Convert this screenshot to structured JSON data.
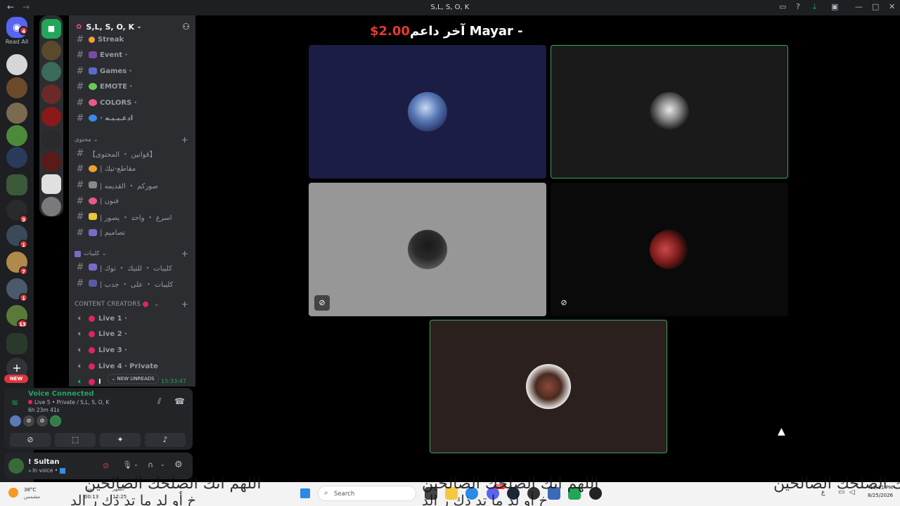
{
  "titlebar": {
    "title": "S,L, S, O, K"
  },
  "rail": {
    "read_all": "Read All",
    "new_badge": "NEW",
    "dm_badge": "4",
    "badges": [
      "3",
      "1",
      "7",
      "1",
      "13"
    ]
  },
  "server": {
    "name": "S,L, S, O, K"
  },
  "channels": [
    {
      "name": "Streak"
    },
    {
      "name": "Event ·"
    },
    {
      "name": "Games ·"
    },
    {
      "name": "EMOTE ·"
    },
    {
      "name": "COLORS ·"
    },
    {
      "name": "· ادعـيـيـه"
    }
  ],
  "categories": {
    "content": "محتوى",
    "clips": "كليبات",
    "creators": "CONTENT CREATORS"
  },
  "content_channels": [
    {
      "name": "【قوانين ・ المحتوى】"
    },
    {
      "name": "| مقاطع-تيك"
    },
    {
      "name": "| صوركم ・ القديمه"
    },
    {
      "name": "| فنون"
    },
    {
      "name": "| اسرع ・ واحد ・ يصور"
    },
    {
      "name": "| تصاميم"
    }
  ],
  "clip_channels": [
    {
      "name": "| كليبات ・ للتيك ・ توك"
    },
    {
      "name": "| كليبات ・ على ・ جدب"
    }
  ],
  "voice_channels": [
    {
      "name": "Live 1 ·"
    },
    {
      "name": "Live 2 ·"
    },
    {
      "name": "Live 3 ·"
    },
    {
      "name": "Live 4 · Private"
    }
  ],
  "voice": {
    "new_unreads": "NEW UNREADS",
    "timer": "15:33:47",
    "status": "Voice Connected",
    "location": "Live 5 • Private / S,L, S, O, K",
    "duration": "6h 23m 41s"
  },
  "user": {
    "name": "! Sultan",
    "status": "In voice •"
  },
  "stage": {
    "banner_name": "آخر داعم Mayar - ",
    "banner_amount": "$2.00"
  },
  "taskbar": {
    "weather_temp": "38°C",
    "weather_desc": "مشمس",
    "prayer1": "بعد",
    "prayer1_time": "00:13",
    "prayer2": "الظهر",
    "prayer2_time": "12:25",
    "search": "Search",
    "time": "12:11 PM",
    "date": "8/25/2026",
    "lang": "ع",
    "chat_badge": "99+"
  },
  "overlay": {
    "line1": "اللهم انك الصلحك الصالحين",
    "line2": "خ أو  لد ما تد  ذك ر الد"
  }
}
